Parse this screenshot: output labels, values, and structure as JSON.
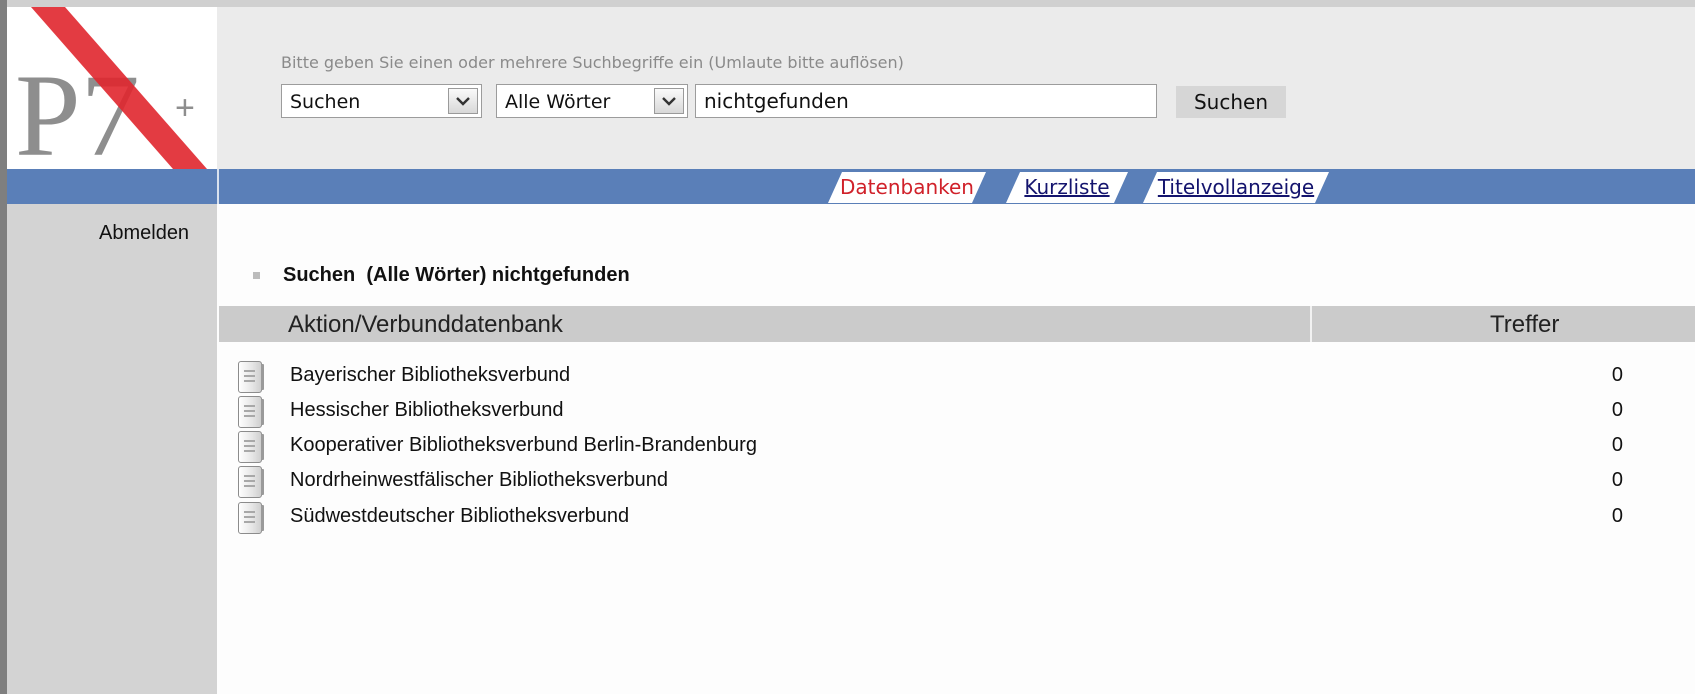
{
  "logo": {
    "main": "P7",
    "plus": "+"
  },
  "search": {
    "hint": "Bitte geben Sie einen oder mehrere Suchbegriffe ein (Umlaute bitte auflösen)",
    "type_select": "Suchen",
    "mode_select": "Alle Wörter",
    "query_value": "nichtgefunden",
    "button_label": "Suchen"
  },
  "tabs": [
    {
      "label": "Datenbanken",
      "active": true
    },
    {
      "label": "Kurzliste",
      "active": false
    },
    {
      "label": "Titelvollanzeige",
      "active": false
    }
  ],
  "sidebar": {
    "logout_label": "Abmelden"
  },
  "results": {
    "query_title": "Suchen  (Alle Wörter) nichtgefunden",
    "columns": {
      "action": "Aktion/Verbunddatenbank",
      "hits": "Treffer"
    },
    "rows": [
      {
        "name": "Bayerischer Bibliotheksverbund",
        "hits": "0"
      },
      {
        "name": "Hessischer Bibliotheksverbund",
        "hits": "0"
      },
      {
        "name": "Kooperativer Bibliotheksverbund Berlin-Brandenburg",
        "hits": "0"
      },
      {
        "name": "Nordrheinwestfälischer Bibliotheksverbund",
        "hits": "0"
      },
      {
        "name": "Südwestdeutscher Bibliotheksverbund",
        "hits": "0"
      }
    ]
  },
  "colors": {
    "nav_bar": "#5a7fb8",
    "active_tab_text": "#d0212a",
    "inactive_tab_text": "#14146e",
    "logo_stripe": "#e0262e",
    "sidebar_bg": "#d3d3d3",
    "header_bg": "#ebebeb"
  },
  "icons": {
    "row_icon": "database-document-icon",
    "select_arrow": "chevron-down-icon"
  }
}
